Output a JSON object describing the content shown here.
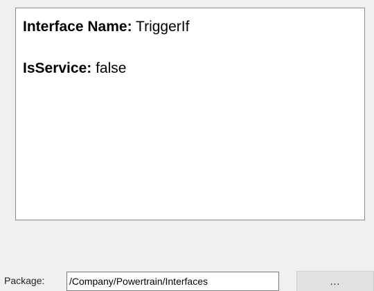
{
  "interface_details": {
    "interface_name_label": "Interface Name:",
    "interface_name_value": "TriggerIf",
    "is_service_label": "IsService:",
    "is_service_value": "false"
  },
  "package": {
    "label": "Package:",
    "value": "/Company/Powertrain/Interfaces",
    "browse_label": "..."
  }
}
